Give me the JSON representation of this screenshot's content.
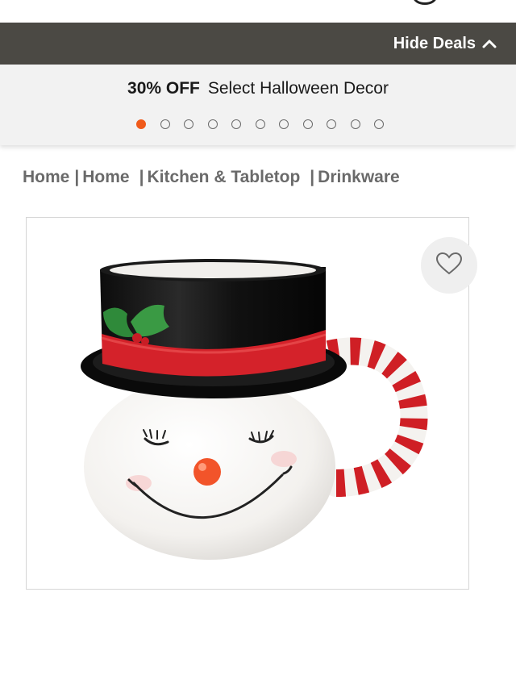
{
  "deals_bar": {
    "hide_label": "Hide Deals",
    "background": "#4b4944",
    "icon": "chevron-up-icon"
  },
  "promo": {
    "discount": "30% OFF",
    "description": "Select Halloween Decor",
    "slide_count": 11,
    "active_slide": 1,
    "accent": "#f05a1a"
  },
  "breadcrumb": {
    "items": [
      "Home",
      "Home",
      "Kitchen & Tabletop",
      "Drinkware"
    ],
    "separator": "|"
  },
  "product": {
    "image_icon": "snowman-mug-image",
    "wishlist_icon": "heart-icon"
  }
}
